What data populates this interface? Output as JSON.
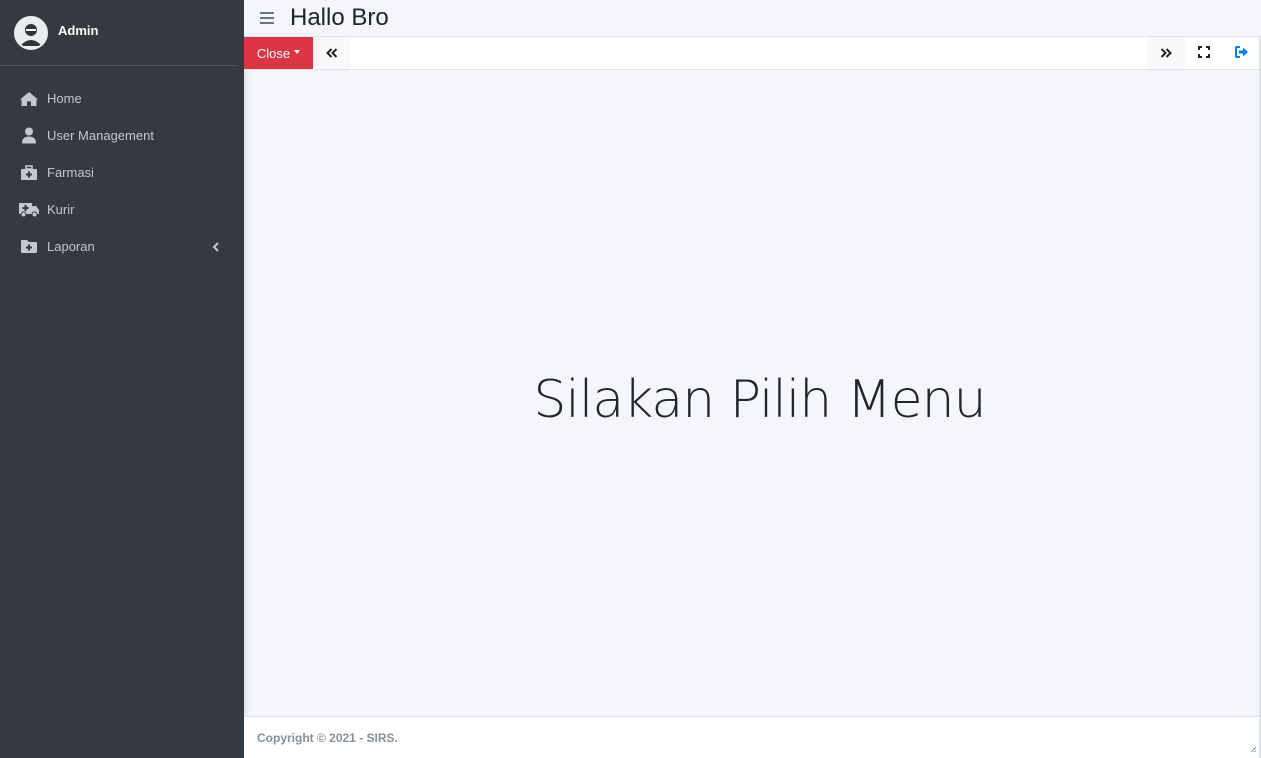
{
  "sidebar": {
    "user_name": "Admin",
    "items": [
      {
        "label": "Home",
        "icon": "home-icon"
      },
      {
        "label": "User Management",
        "icon": "user-icon"
      },
      {
        "label": "Farmasi",
        "icon": "medkit-icon"
      },
      {
        "label": "Kurir",
        "icon": "ambulance-icon"
      },
      {
        "label": "Laporan",
        "icon": "folder-plus-icon"
      }
    ]
  },
  "header": {
    "title": "Hallo Bro"
  },
  "tabbar": {
    "close_label": "Close"
  },
  "content": {
    "welcome_text": "Silakan Pilih Menu"
  },
  "footer": {
    "copyright": "Copyright © 2021 - SIRS."
  },
  "colors": {
    "sidebar_bg": "#343a40",
    "close_button": "#dc3545",
    "logout_icon": "#007bff"
  }
}
